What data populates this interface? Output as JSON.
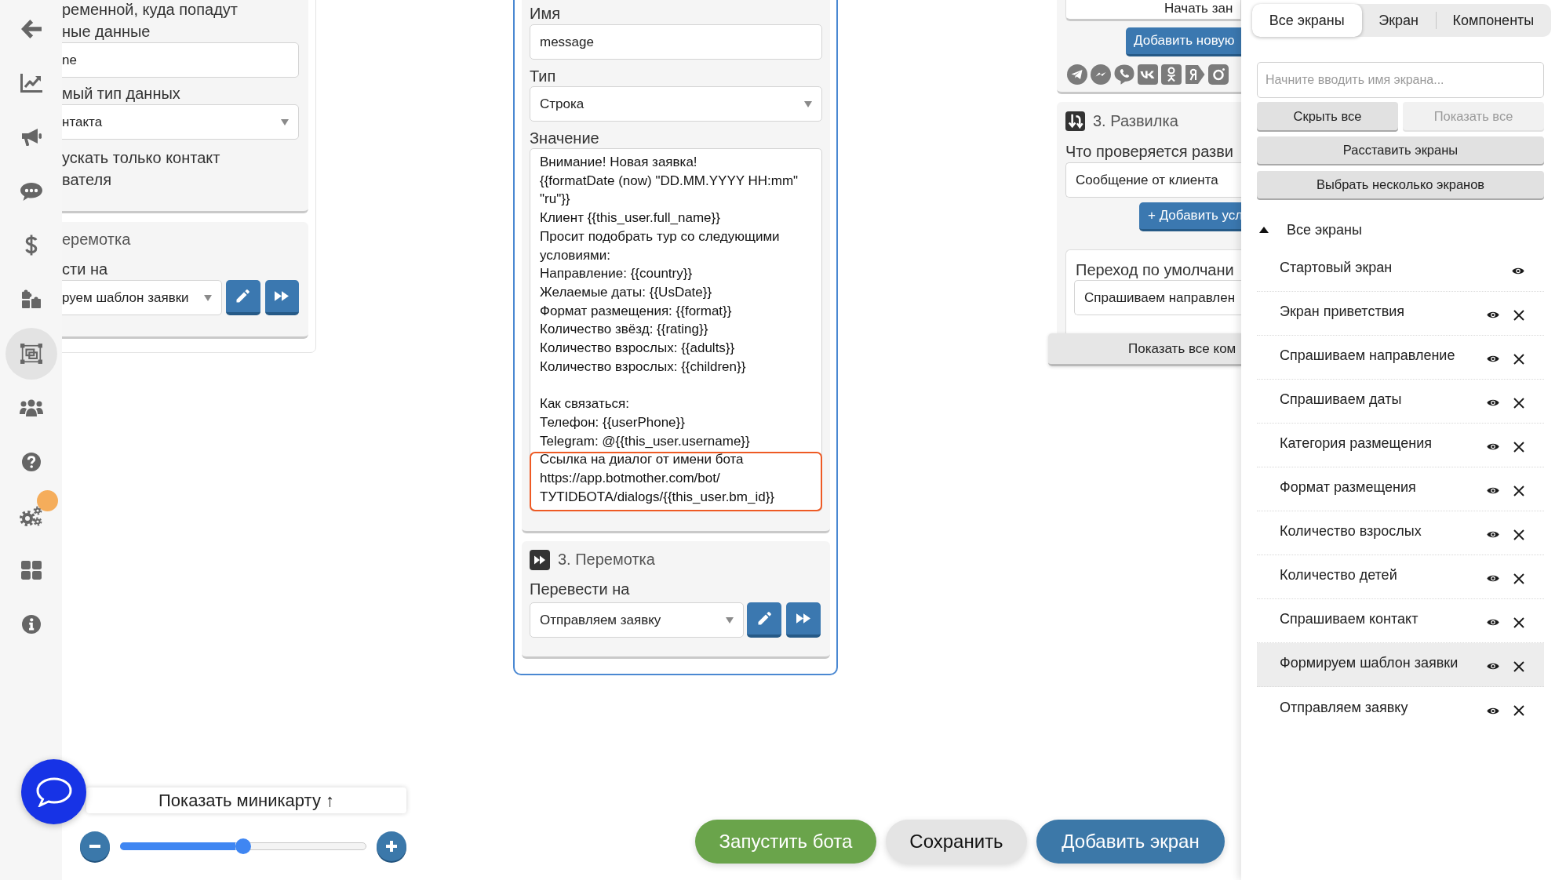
{
  "sidebar": {
    "items": [
      {
        "kind": "back",
        "selected": false,
        "badge": false
      },
      {
        "kind": "analytics",
        "selected": false,
        "badge": false
      },
      {
        "kind": "broadcast",
        "selected": false,
        "badge": false
      },
      {
        "kind": "chats",
        "selected": false,
        "badge": false
      },
      {
        "kind": "payments",
        "selected": false,
        "badge": false
      },
      {
        "kind": "integrations",
        "selected": false,
        "badge": false
      },
      {
        "kind": "screens",
        "selected": true,
        "badge": false
      },
      {
        "kind": "users",
        "selected": false,
        "badge": false
      },
      {
        "kind": "help",
        "selected": false,
        "badge": false
      },
      {
        "kind": "settings",
        "selected": false,
        "badge": true
      },
      {
        "kind": "apps",
        "selected": false,
        "badge": false
      },
      {
        "kind": "info",
        "selected": false,
        "badge": false
      }
    ]
  },
  "canvas": {
    "left_screen": {
      "variable_block": {
        "description": [
          "ременной, куда попадут",
          "ные данные"
        ],
        "variable_value": "ne",
        "type_label": "мый тип данных",
        "type_value": "нтакта",
        "option_label": [
          "ускать только контакт",
          "вателя"
        ]
      },
      "rewind_block": {
        "title": "еремотка",
        "target_label": "сти на",
        "target_value": "руем шаблон заявки"
      }
    },
    "variable_screen": {
      "variable_block": {
        "name_label": "Имя",
        "name_value": "message",
        "type_label": "Тип",
        "type_value": "Строка",
        "value_label": "Значение",
        "value": "Внимание! Новая заявка!\n{{formatDate (now) \"DD.MM.YYYY HH:mm\"\n\"ru\"}}\nКлиент {{this_user.full_name}}\nПросит подобрать тур со следующими\nусловиями:\nНаправление: {{country}}\nЖелаемые даты: {{UsDate}}\nФормат размещения: {{format}}\nКоличество звёзд: {{rating}}\nКоличество взрослых: {{adults}}\nКоличество взрослых: {{children}}\n\nКак связаться:\nТелефон: {{userPhone}}\nTelegram: @{{this_user.username}}",
        "highlighted_value": "Ссылка на диалог от имени бота\nhttps://app.botmother.com/bot/\nТУТIDБОТА/dialogs/{{this_user.bm_id}}"
      },
      "rewind_block": {
        "title": "3. Перемотка",
        "target_label": "Перевести на",
        "target_value": "Отправляем заявку"
      }
    },
    "fork_screen": {
      "reply_button": "Начать зан",
      "add_button": "Добавить новую",
      "fork_block": {
        "title": "3. Развилка",
        "check_label": "Что проверяется разви",
        "check_value": "Сообщение от клиента",
        "add_condition_button": "+ Добавить усл",
        "default_label": "Переход по умолчани",
        "default_value": "Спрашиваем направлен"
      },
      "show_components_button": "Показать все ком"
    },
    "minimap_button": "Показать миникарту ↑",
    "zoom": {
      "level": 0.5
    },
    "actions": [
      {
        "kind": "run",
        "label": "Запустить бота"
      },
      {
        "kind": "save",
        "label": "Сохранить"
      },
      {
        "kind": "add",
        "label": "Добавить экран"
      }
    ]
  },
  "screens_panel": {
    "tabs": [
      {
        "label": "Все экраны",
        "selected": true
      },
      {
        "label": "Экран",
        "selected": false
      },
      {
        "label": "Компоненты",
        "selected": false
      }
    ],
    "search": {
      "placeholder": "Начните вводить имя экрана..."
    },
    "buttons": [
      {
        "label": "Скрыть все",
        "disabled": false
      },
      {
        "label": "Показать все",
        "disabled": true
      }
    ],
    "arrange_button": "Расставить экраны",
    "multi_select_button": "Выбрать несколько экранов",
    "tree": {
      "label": "Все экраны",
      "expanded": true,
      "children": [
        {
          "label": "Стартовый экран",
          "selected": false,
          "deletable": false
        },
        {
          "label": "Экран приветствия",
          "selected": false,
          "deletable": true
        },
        {
          "label": "Спрашиваем направление",
          "selected": false,
          "deletable": true
        },
        {
          "label": "Спрашиваем даты",
          "selected": false,
          "deletable": true
        },
        {
          "label": "Категория размещения",
          "selected": false,
          "deletable": true
        },
        {
          "label": "Формат размещения",
          "selected": false,
          "deletable": true
        },
        {
          "label": "Количество взрослых",
          "selected": false,
          "deletable": true
        },
        {
          "label": "Количество детей",
          "selected": false,
          "deletable": true
        },
        {
          "label": "Спрашиваем контакт",
          "selected": false,
          "deletable": true
        },
        {
          "label": "Формируем шаблон заявки",
          "selected": true,
          "deletable": true
        },
        {
          "label": "Отправляем заявку",
          "selected": false,
          "deletable": true
        }
      ]
    }
  }
}
